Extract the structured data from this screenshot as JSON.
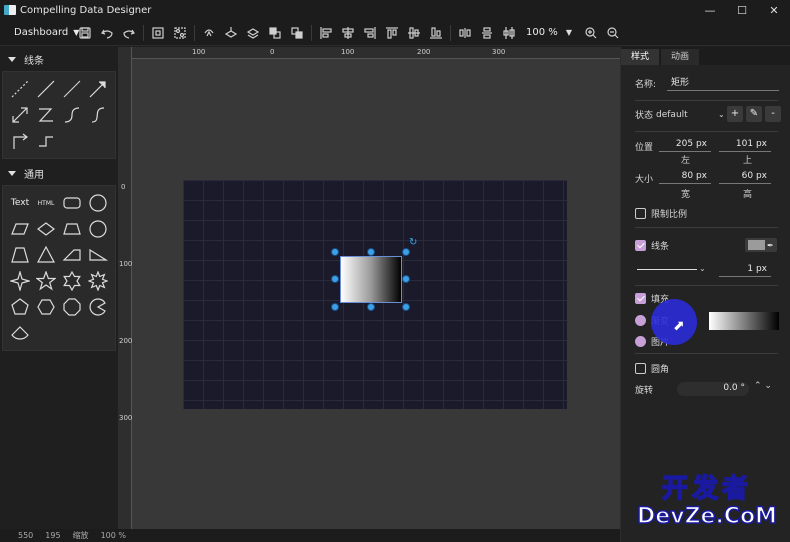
{
  "window": {
    "title": "Compelling Data Designer"
  },
  "toolbar": {
    "page_selector": "Dashboard",
    "zoom_value": "100 %"
  },
  "left_panel": {
    "sections": [
      {
        "title": "线条"
      },
      {
        "title": "通用"
      }
    ],
    "general_shapes": {
      "text_label": "Text",
      "html_label": "HTML"
    }
  },
  "rulers": {
    "horizontal": [
      "100",
      "0",
      "100",
      "200",
      "300"
    ],
    "vertical": [
      "0",
      "100",
      "200",
      "300"
    ]
  },
  "status": {
    "x": "550",
    "y": "195",
    "zoom_label": "缩放",
    "zoom": "100 %"
  },
  "right_panel": {
    "tabs": [
      "样式",
      "动画"
    ],
    "name_label": "名称:",
    "name_value": "矩形",
    "state_label": "状态",
    "state_value": "default",
    "position_label": "位置",
    "pos_x": "205 px",
    "pos_y": "101 px",
    "left_label": "左",
    "top_label": "上",
    "size_label": "大小",
    "width": "80 px",
    "height": "60 px",
    "width_label": "宽",
    "height_label": "高",
    "lock_ratio_label": "限制比例",
    "stroke_label": "线条",
    "stroke_width": "1 px",
    "fill_label": "填充",
    "gradient_label": "渐变",
    "image_label": "图片",
    "round_corner_label": "圆角",
    "rotation_label": "旋转",
    "rotation_value": "0.0 °",
    "colors": {
      "stroke_swatch": "#9b9b9b",
      "accent": "#c7a0d8",
      "selection_handle": "#3da0e6"
    }
  },
  "watermark": {
    "top": "开发者",
    "bottom": "DevZe.CoM"
  }
}
